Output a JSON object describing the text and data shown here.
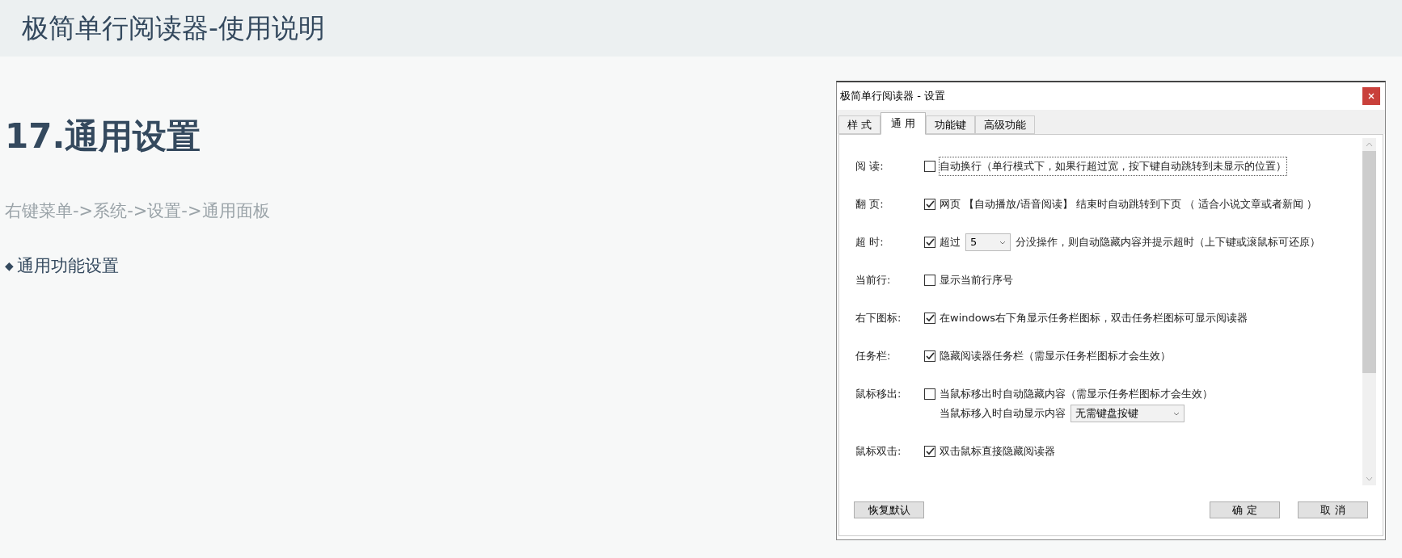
{
  "header": {
    "title": "极简单行阅读器-使用说明"
  },
  "article": {
    "heading": "17.通用设置",
    "path": "右键菜单->系统->设置->通用面板",
    "bullet": "◆",
    "bullet_text": "通用功能设置"
  },
  "dialog": {
    "title": "极简单行阅读器 - 设置",
    "tabs": [
      {
        "label": "样 式",
        "selected": false
      },
      {
        "label": "通 用",
        "selected": true
      },
      {
        "label": "功能键",
        "selected": false
      },
      {
        "label": "高级功能",
        "selected": false
      }
    ],
    "rows": [
      {
        "label": "阅 读:",
        "checked": false,
        "focused": true,
        "parts": [
          {
            "kind": "text",
            "text": "自动换行（单行模式下，如果行超过宽，按下键自动跳转到未显示的位置）"
          }
        ]
      },
      {
        "label": "翻 页:",
        "checked": true,
        "focused": false,
        "parts": [
          {
            "kind": "text",
            "text": "网页 【自动播放/语音阅读】 结束时自动跳转到下页 （ 适合小说文章或者新闻 ）"
          }
        ]
      },
      {
        "label": "超 时:",
        "checked": true,
        "focused": false,
        "parts": [
          {
            "kind": "text",
            "text": "超过"
          },
          {
            "kind": "select",
            "value": "5"
          },
          {
            "kind": "text",
            "text": "分没操作，则自动隐藏内容并提示超时（上下键或滚鼠标可还原）"
          }
        ]
      },
      {
        "label": "当前行:",
        "checked": false,
        "focused": false,
        "parts": [
          {
            "kind": "text",
            "text": "显示当前行序号"
          }
        ]
      },
      {
        "label": "右下图标:",
        "checked": true,
        "focused": false,
        "parts": [
          {
            "kind": "text",
            "text": "在windows右下角显示任务栏图标，双击任务栏图标可显示阅读器"
          }
        ]
      },
      {
        "label": "任务栏:",
        "checked": true,
        "focused": false,
        "parts": [
          {
            "kind": "text",
            "text": "隐藏阅读器任务栏（需显示任务栏图标才会生效）"
          }
        ]
      },
      {
        "label": "鼠标移出:",
        "checked": false,
        "focused": false,
        "parts": [
          {
            "kind": "text",
            "text": "当鼠标移出时自动隐藏内容（需显示任务栏图标才会生效）"
          }
        ],
        "sub": {
          "text": "当鼠标移入时自动显示内容",
          "select": "无需键盘按键"
        }
      },
      {
        "label": "鼠标双击:",
        "checked": true,
        "focused": false,
        "parts": [
          {
            "kind": "text",
            "text": "双击鼠标直接隐藏阅读器"
          }
        ]
      }
    ],
    "buttons": {
      "reset": "恢复默认",
      "ok": "确 定",
      "cancel": "取 消"
    }
  }
}
